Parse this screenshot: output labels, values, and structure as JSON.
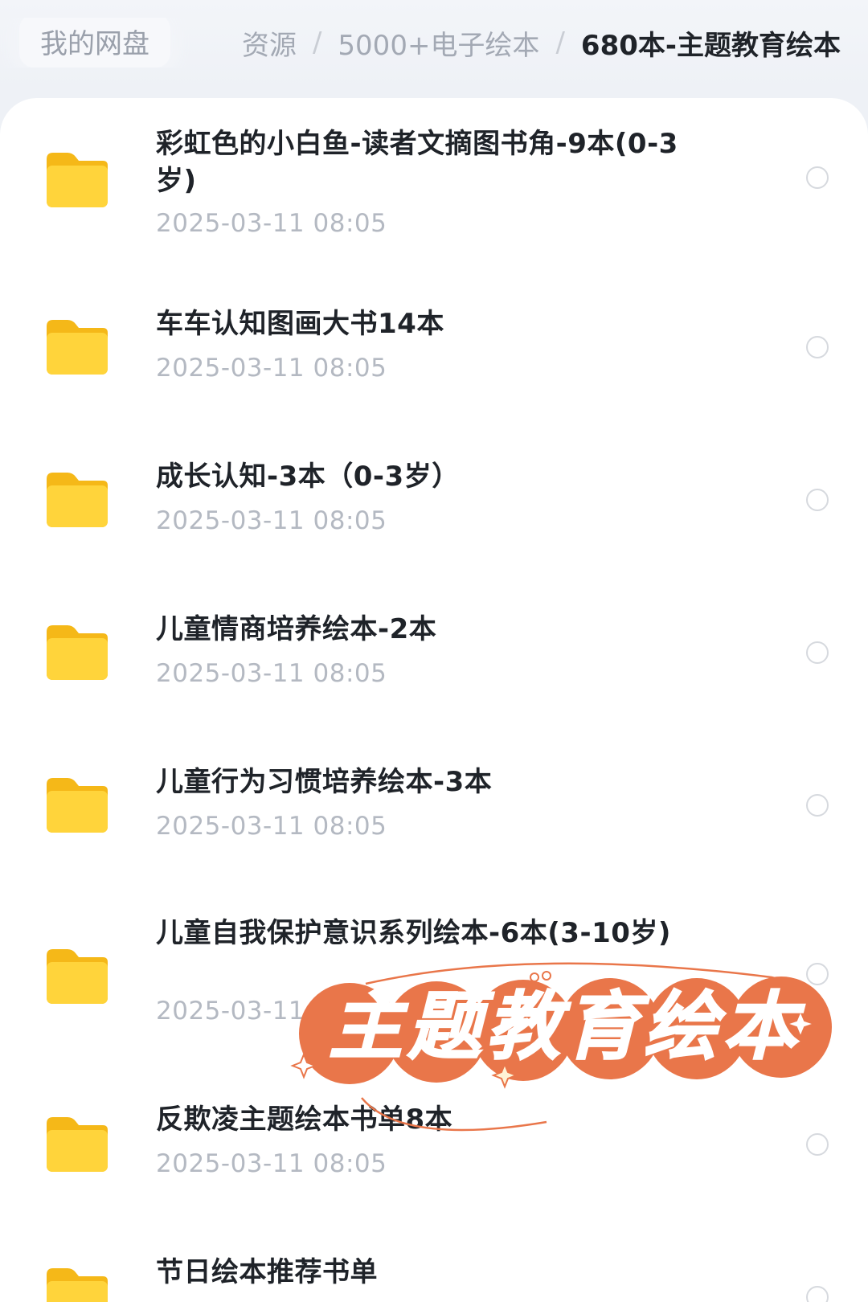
{
  "breadcrumb": {
    "home": "我的网盘",
    "items": [
      "资源",
      "5000+电子绘本",
      "680本-主题教育绘本"
    ]
  },
  "files": [
    {
      "name": "彩虹色的小白鱼-读者文摘图书角-9本(0-3岁)",
      "date": "2025-03-11 08:05"
    },
    {
      "name": "车车认知图画大书14本",
      "date": "2025-03-11 08:05"
    },
    {
      "name": "成长认知-3本（0-3岁）",
      "date": "2025-03-11 08:05"
    },
    {
      "name": "儿童情商培养绘本-2本",
      "date": "2025-03-11 08:05"
    },
    {
      "name": "儿童行为习惯培养绘本-3本",
      "date": "2025-03-11 08:05"
    },
    {
      "name": "儿童自我保护意识系列绘本-6本(3-10岁)",
      "date": "2025-03-11 08:05"
    },
    {
      "name": "反欺凌主题绘本书单8本",
      "date": "2025-03-11 08:05"
    },
    {
      "name": "节日绘本推荐书单",
      "date": ""
    }
  ],
  "overlay": {
    "banner_text": "主题教育绘本"
  },
  "colors": {
    "folder": "#ffd43b",
    "banner": "#e9764a",
    "background": "#eef1f6"
  },
  "icons": {
    "folder": "folder-icon",
    "select": "radio-circle-icon"
  }
}
